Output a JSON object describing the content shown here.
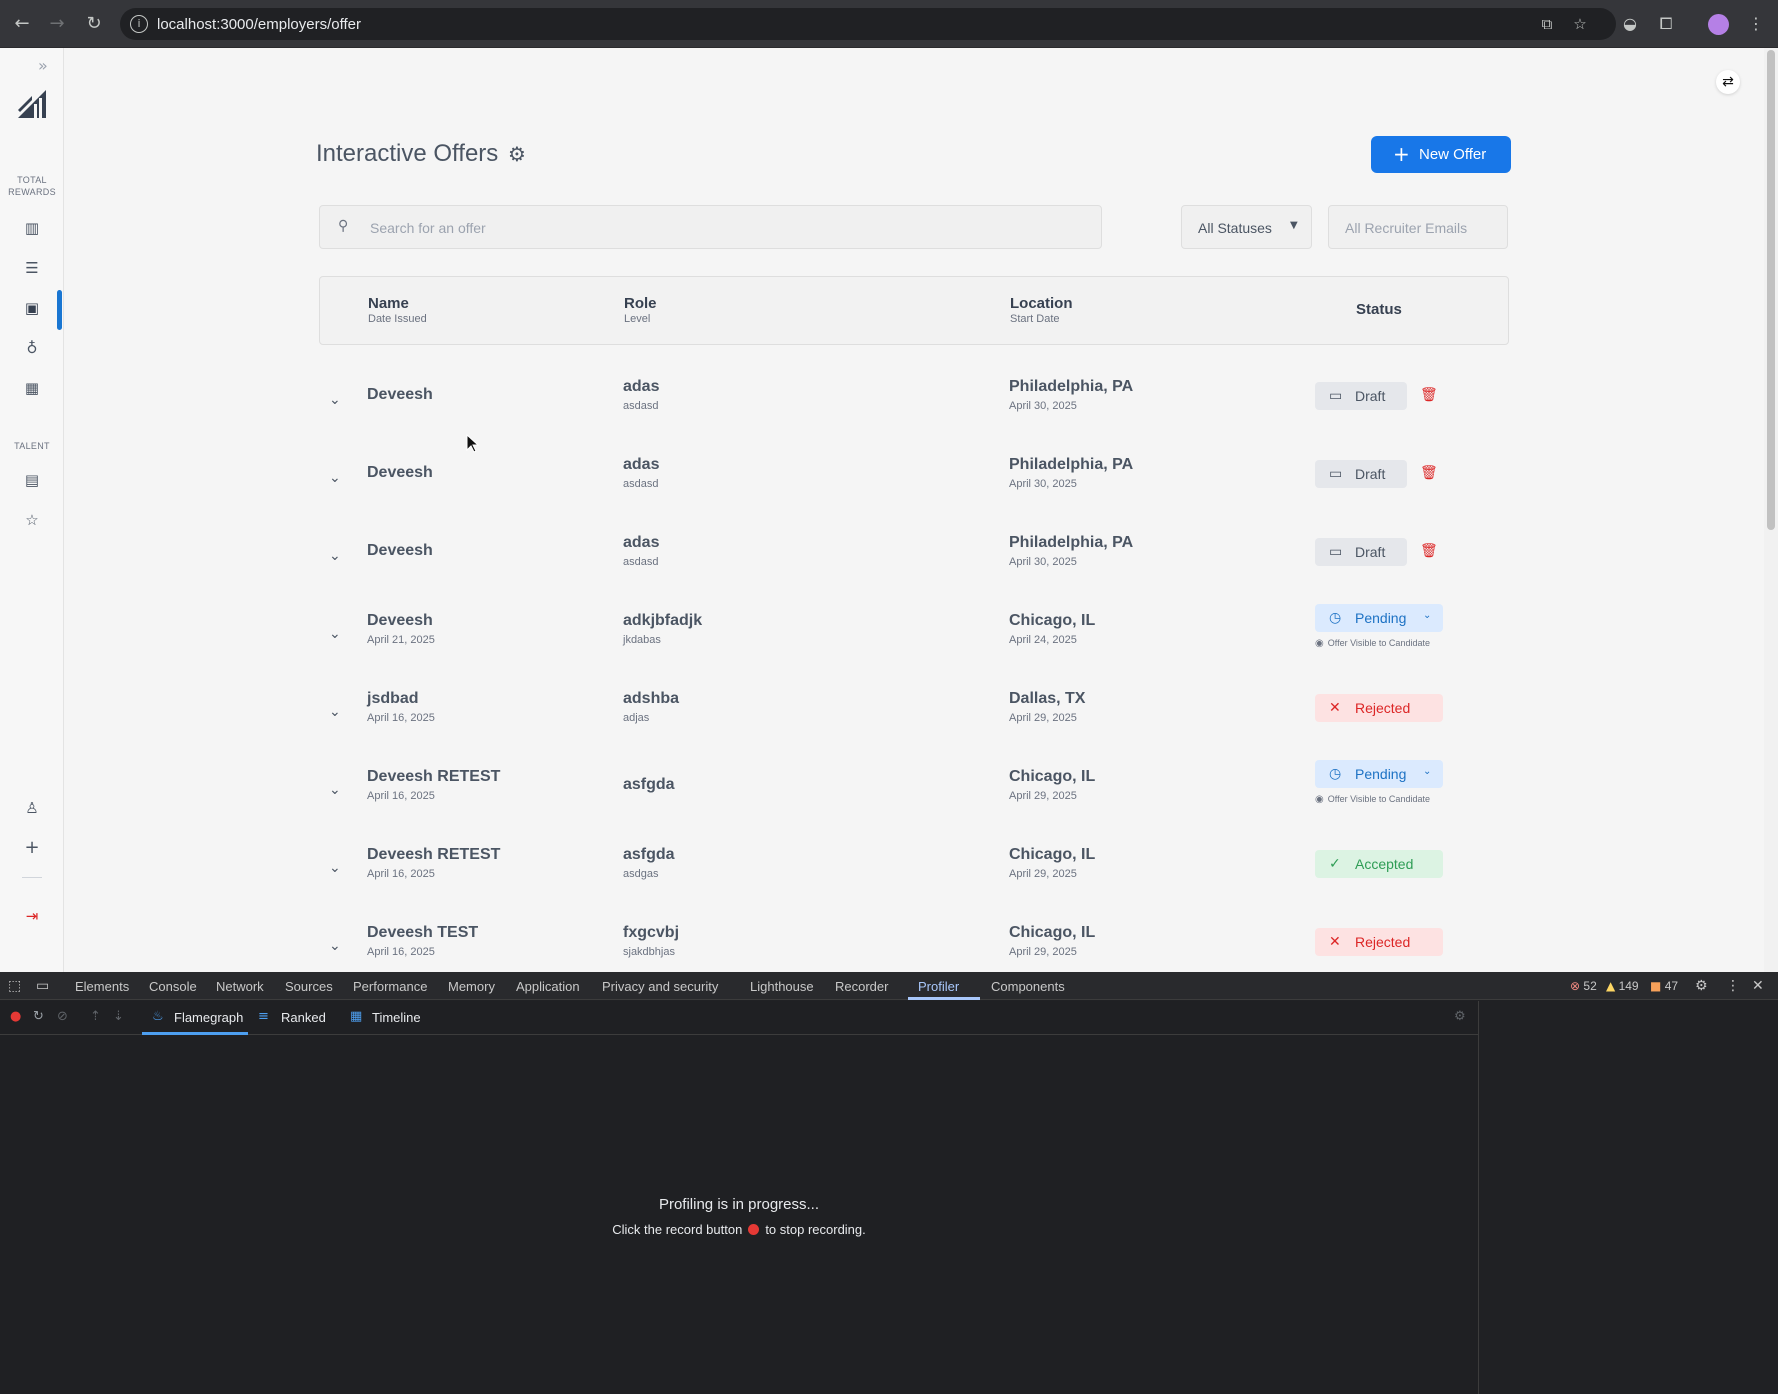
{
  "browser": {
    "url": "localhost:3000/employers/offer"
  },
  "sidebar": {
    "section_rewards": "TOTAL\nREWARDS",
    "section_rewards_l1": "TOTAL",
    "section_rewards_l2": "REWARDS",
    "section_talent": "TALENT"
  },
  "page": {
    "title": "Interactive Offers",
    "new_button": "New Offer",
    "search_placeholder": "Search for an offer",
    "status_filter": "All Statuses",
    "email_filter_placeholder": "All Recruiter Emails"
  },
  "table": {
    "headers": {
      "name": "Name",
      "name_sub": "Date Issued",
      "role": "Role",
      "role_sub": "Level",
      "location": "Location",
      "location_sub": "Start Date",
      "status": "Status"
    },
    "rows": [
      {
        "name": "Deveesh",
        "date": "",
        "role": "adas",
        "level": "asdasd",
        "location": "Philadelphia, PA",
        "start": "April 30, 2025",
        "status": "Draft"
      },
      {
        "name": "Deveesh",
        "date": "",
        "role": "adas",
        "level": "asdasd",
        "location": "Philadelphia, PA",
        "start": "April 30, 2025",
        "status": "Draft"
      },
      {
        "name": "Deveesh",
        "date": "",
        "role": "adas",
        "level": "asdasd",
        "location": "Philadelphia, PA",
        "start": "April 30, 2025",
        "status": "Draft"
      },
      {
        "name": "Deveesh",
        "date": "April 21, 2025",
        "role": "adkjbfadjk",
        "level": "jkdabas",
        "location": "Chicago, IL",
        "start": "April 24, 2025",
        "status": "Pending",
        "note": "Offer Visible to Candidate"
      },
      {
        "name": "jsdbad",
        "date": "April 16, 2025",
        "role": "adshba",
        "level": "adjas",
        "location": "Dallas, TX",
        "start": "April 29, 2025",
        "status": "Rejected"
      },
      {
        "name": "Deveesh RETEST",
        "date": "April 16, 2025",
        "role": "asfgda",
        "level": "",
        "location": "Chicago, IL",
        "start": "April 29, 2025",
        "status": "Pending",
        "note": "Offer Visible to Candidate"
      },
      {
        "name": "Deveesh RETEST",
        "date": "April 16, 2025",
        "role": "asfgda",
        "level": "asdgas",
        "location": "Chicago, IL",
        "start": "April 29, 2025",
        "status": "Accepted"
      },
      {
        "name": "Deveesh TEST",
        "date": "April 16, 2025",
        "role": "fxgcvbj",
        "level": "sjakdbhjas",
        "location": "Chicago, IL",
        "start": "April 29, 2025",
        "status": "Rejected"
      }
    ]
  },
  "devtools": {
    "tabs": [
      "Elements",
      "Console",
      "Network",
      "Sources",
      "Performance",
      "Memory",
      "Application",
      "Privacy and security",
      "Lighthouse",
      "Recorder",
      "Profiler",
      "Components"
    ],
    "active_tab": "Profiler",
    "errors": "52",
    "warnings": "149",
    "issues": "47",
    "subtabs": [
      "Flamegraph",
      "Ranked",
      "Timeline"
    ],
    "progress_title": "Profiling is in progress...",
    "progress_sub_pre": "Click the record button",
    "progress_sub_post": "to stop recording."
  },
  "colors": {
    "accent": "#1877e8",
    "draft_bg": "#e5e7eb",
    "pending_bg": "#dbeafe",
    "rejected_bg": "#fde2e2",
    "accepted_bg": "#dcf3e3"
  }
}
